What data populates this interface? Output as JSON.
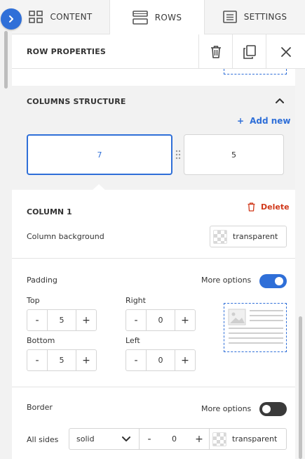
{
  "tabs": [
    {
      "label": "CONTENT",
      "icon": "grid-icon"
    },
    {
      "label": "ROWS",
      "icon": "rows-icon"
    },
    {
      "label": "SETTINGS",
      "icon": "settings-icon"
    }
  ],
  "row_properties": {
    "title": "ROW PROPERTIES",
    "actions": [
      "trash-icon",
      "duplicate-icon",
      "close-icon"
    ]
  },
  "columns_structure": {
    "title": "COLUMNS STRUCTURE",
    "add_new": "Add new",
    "columns": [
      "7",
      "5"
    ]
  },
  "column1": {
    "title": "COLUMN 1",
    "delete_label": "Delete",
    "background_label": "Column background",
    "background_value": "transparent"
  },
  "padding": {
    "label": "Padding",
    "more_options_label": "More options",
    "more_options_on": true,
    "top_label": "Top",
    "top_value": "5",
    "right_label": "Right",
    "right_value": "0",
    "bottom_label": "Bottom",
    "bottom_value": "5",
    "left_label": "Left",
    "left_value": "0",
    "minus": "-",
    "plus": "+"
  },
  "border": {
    "label": "Border",
    "more_options_label": "More options",
    "more_options_on": false,
    "all_sides_label": "All sides",
    "style_value": "solid",
    "width_value": "0",
    "color_value": "transparent",
    "minus": "-",
    "plus": "+"
  },
  "colors": {
    "accent": "#2f6fd8",
    "danger": "#d0391b",
    "panel_bg": "#f2f2f2"
  }
}
